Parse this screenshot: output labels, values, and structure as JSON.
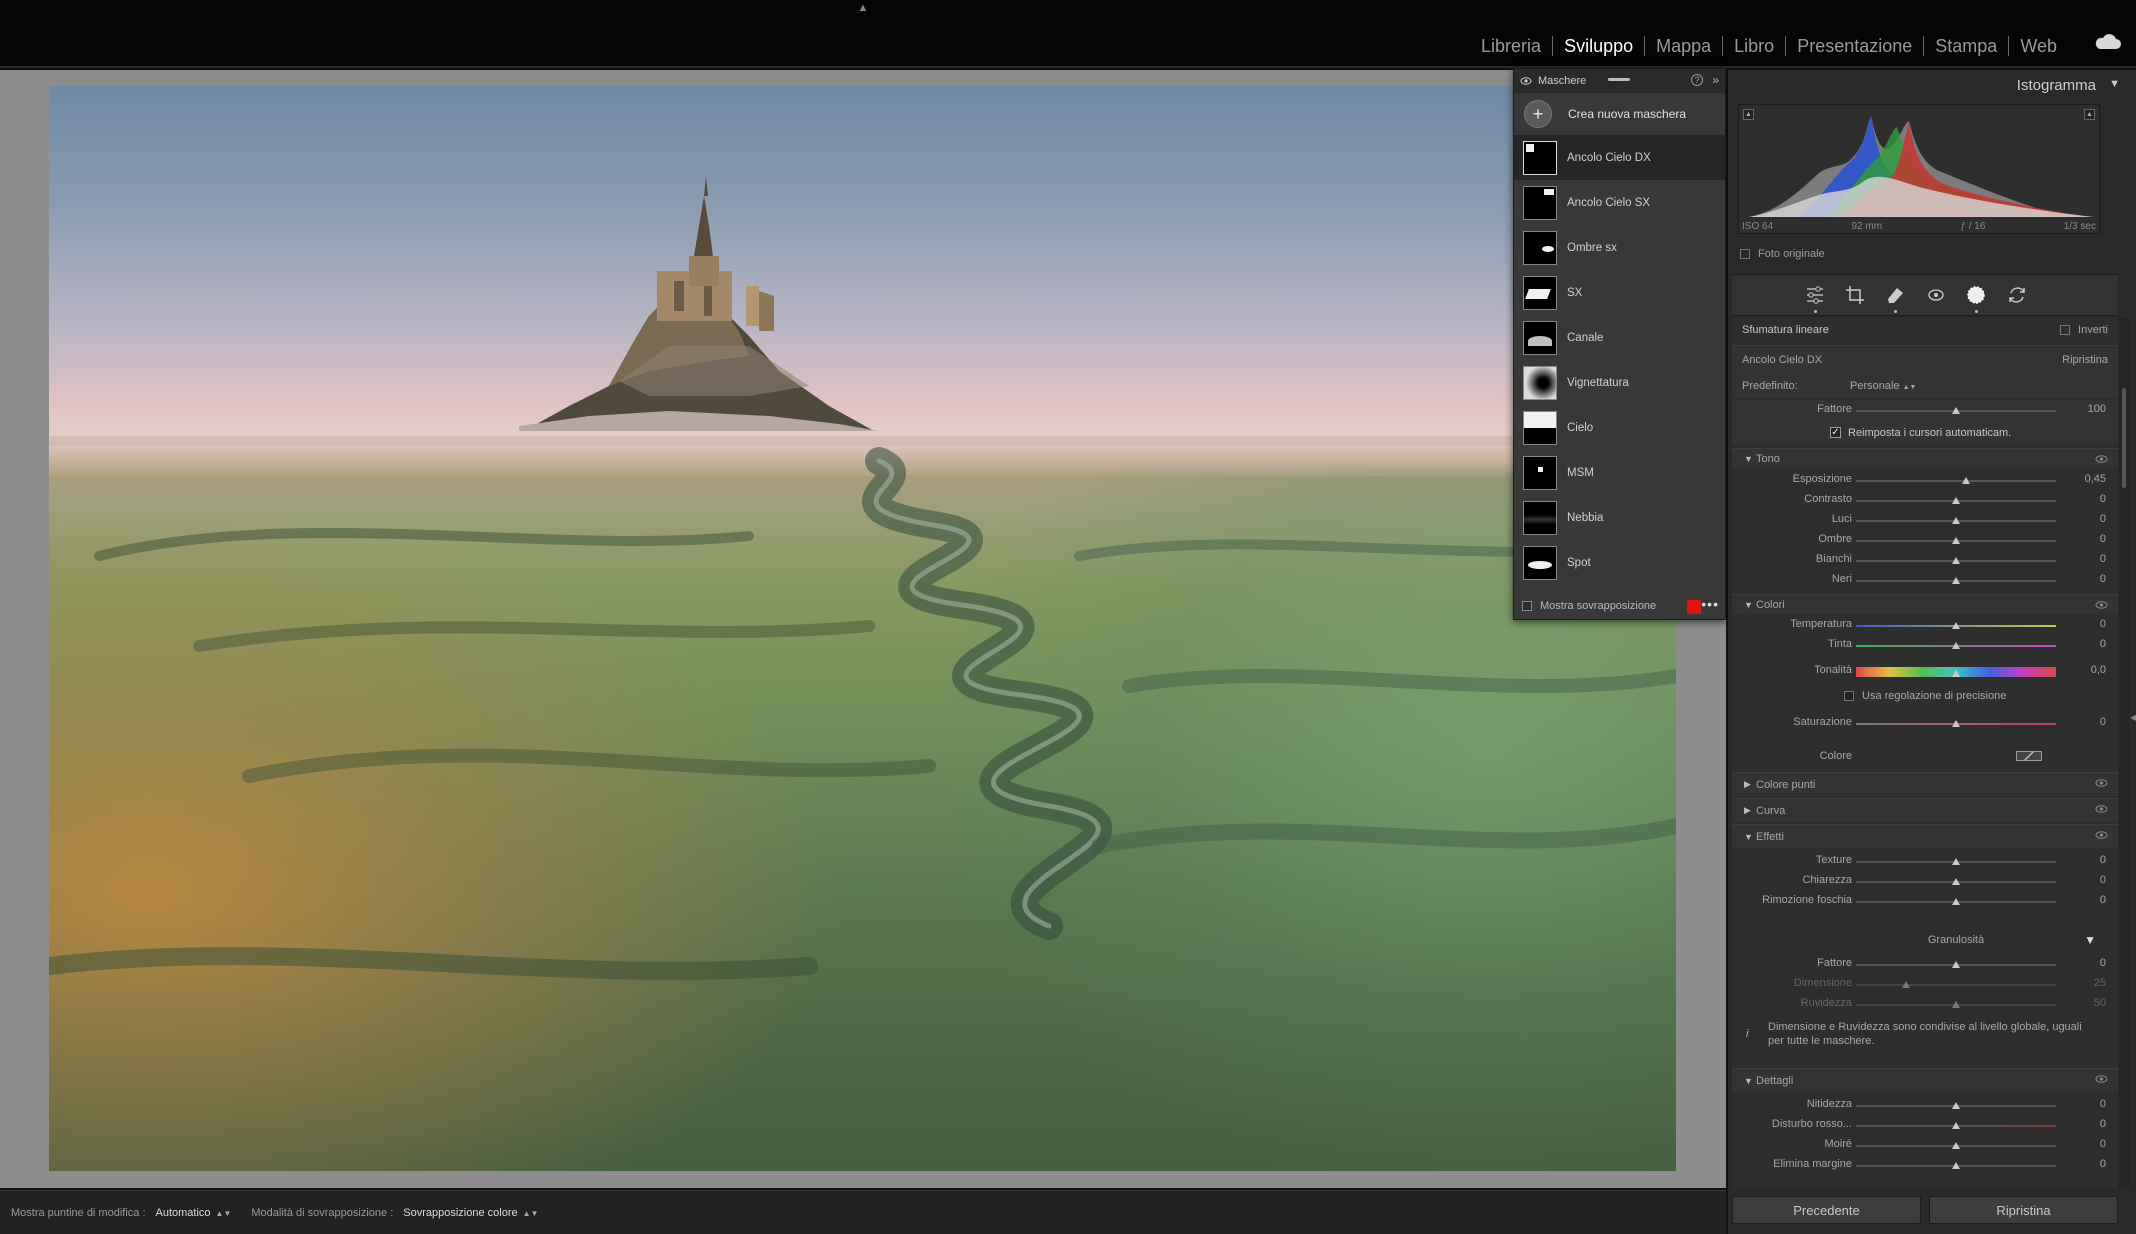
{
  "modules": [
    "Libreria",
    "Sviluppo",
    "Mappa",
    "Libro",
    "Presentazione",
    "Stampa",
    "Web"
  ],
  "active_module": "Sviluppo",
  "masks_panel": {
    "title": "Maschere",
    "create_label": "Crea nuova maschera",
    "items": [
      "Ancolo Cielo DX",
      "Ancolo Cielo SX",
      "Ombre sx",
      "SX",
      "Canale",
      "Vignettatura",
      "Cielo",
      "MSM",
      "Nebbia",
      "Spot"
    ],
    "selected": "Ancolo Cielo DX",
    "overlay_label": "Mostra sovrapposizione",
    "overlay_color": "#e0140f"
  },
  "toolbar": {
    "pins_label": "Mostra puntine di modifica :",
    "pins_value": "Automatico",
    "overlay_mode_label": "Modalità di sovrapposizione :",
    "overlay_mode_value": "Sovrapposizione colore"
  },
  "histogram": {
    "title": "Istogramma",
    "iso": "ISO 64",
    "focal": "92 mm",
    "aperture": "ƒ / 16",
    "shutter": "1/3 sec",
    "original_label": "Foto originale"
  },
  "mask_settings": {
    "type_label": "Sfumatura lineare",
    "invert_label": "Inverti",
    "mask_name": "Ancolo Cielo DX",
    "reset_label": "Ripristina",
    "preset_label": "Predefinito:",
    "preset_value": "Personale",
    "amount_label": "Fattore",
    "amount_value": "100",
    "auto_reset_label": "Reimposta i cursori automaticam."
  },
  "tone": {
    "title": "Tono",
    "sliders": [
      {
        "label": "Esposizione",
        "value": "0,45",
        "pos": 0.55
      },
      {
        "label": "Contrasto",
        "value": "0",
        "pos": 0.5
      },
      {
        "label": "Luci",
        "value": "0",
        "pos": 0.5
      },
      {
        "label": "Ombre",
        "value": "0",
        "pos": 0.5
      },
      {
        "label": "Bianchi",
        "value": "0",
        "pos": 0.5
      },
      {
        "label": "Neri",
        "value": "0",
        "pos": 0.5
      }
    ]
  },
  "colors": {
    "title": "Colori",
    "temperature_label": "Temperatura",
    "temperature_value": "0",
    "tint_label": "Tinta",
    "tint_value": "0",
    "hue_label": "Tonalità",
    "hue_value": "0,0",
    "fine_label": "Usa regolazione di precisione",
    "saturation_label": "Saturazione",
    "saturation_value": "0",
    "color_label": "Colore"
  },
  "collapsed_sections": [
    "Colore punti",
    "Curva"
  ],
  "effects": {
    "title": "Effetti",
    "sliders": [
      {
        "label": "Texture",
        "value": "0"
      },
      {
        "label": "Chiarezza",
        "value": "0"
      },
      {
        "label": "Rimozione foschia",
        "value": "0"
      }
    ],
    "grain_title": "Granulosità",
    "grain": [
      {
        "label": "Fattore",
        "value": "0",
        "pos": 0.5,
        "dim": false
      },
      {
        "label": "Dimensione",
        "value": "25",
        "pos": 0.25,
        "dim": true
      },
      {
        "label": "Ruvidezza",
        "value": "50",
        "pos": 0.5,
        "dim": true
      }
    ],
    "info": "Dimensione e Ruvidezza sono condivise al livello globale, uguali per tutte le maschere."
  },
  "details": {
    "title": "Dettagli",
    "sliders": [
      {
        "label": "Nitidezza",
        "value": "0"
      },
      {
        "label": "Disturbo rosso...",
        "value": "0"
      },
      {
        "label": "Moiré",
        "value": "0"
      },
      {
        "label": "Elimina margine",
        "value": "0"
      }
    ]
  },
  "buttons": {
    "previous": "Precedente",
    "reset": "Ripristina"
  }
}
